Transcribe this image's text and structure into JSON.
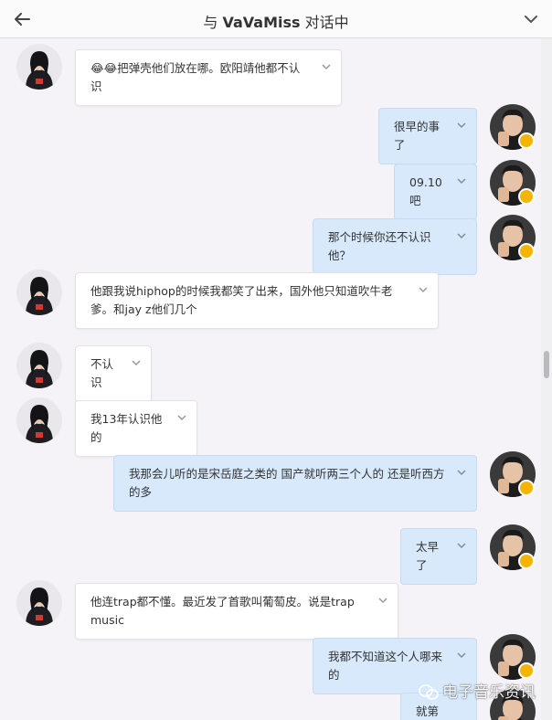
{
  "header": {
    "prefix": "与",
    "contact_name": "VaVaMiss",
    "suffix": "对话中"
  },
  "messages": [
    {
      "side": "left",
      "text": "😂😂把弹壳他们放在哪。欧阳靖他都不认识"
    },
    {
      "side": "right",
      "text": "很早的事了"
    },
    {
      "side": "right",
      "text": "09.10吧"
    },
    {
      "side": "right",
      "text": "那个时候你还不认识他？"
    },
    {
      "side": "left",
      "text": "他跟我说hiphop的时候我都笑了出来，国外他只知道吹牛老爹。和jay z他们几个"
    },
    {
      "side": "left",
      "text": "不认识"
    },
    {
      "side": "left",
      "text": "我13年认识他的"
    },
    {
      "side": "right",
      "text": "我那会儿听的是宋岳庭之类的 国产就听两三个人的 还是听西方的多"
    },
    {
      "side": "right",
      "text": "太早了"
    },
    {
      "side": "left",
      "text": "他连trap都不懂。最近发了首歌叫葡萄皮。说是trap music"
    },
    {
      "side": "right",
      "text": "我都不知道这个人哪来的"
    },
    {
      "side": "right",
      "text": "就第一"
    }
  ],
  "watermark": "电子音乐资讯",
  "colors": {
    "left_bubble": "#ffffff",
    "right_bubble": "#d7e9fb",
    "background": "#f5f3f7",
    "verified_badge": "#f4b400"
  },
  "icons": {
    "back": "arrow-left-icon",
    "menu": "chevron-down-icon",
    "bubble_menu": "chevron-down-icon",
    "verified": "verified-badge-icon"
  }
}
